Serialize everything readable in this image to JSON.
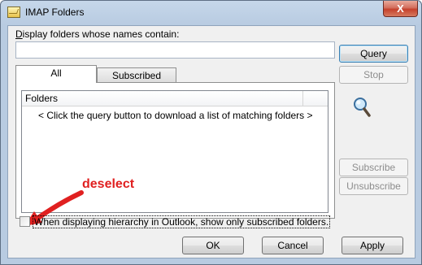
{
  "window": {
    "title": "IMAP Folders",
    "close_glyph": "X"
  },
  "search": {
    "label": "Display folders whose names contain:",
    "value": ""
  },
  "buttons": {
    "query": "Query",
    "stop": "Stop",
    "subscribe": "Subscribe",
    "unsubscribe": "Unsubscribe",
    "ok": "OK",
    "cancel": "Cancel",
    "apply": "Apply"
  },
  "tabs": [
    {
      "label": "All",
      "selected": true
    },
    {
      "label": "Subscribed",
      "selected": false
    }
  ],
  "list": {
    "columns": [
      "Folders"
    ],
    "empty_message": "< Click the query button to download a list of matching folders >"
  },
  "option": {
    "label": "When displaying hierarchy in Outlook, show only subscribed folders.",
    "checked": false
  },
  "annotation": {
    "text": "deselect",
    "color": "#e02020"
  },
  "icons": {
    "app": "folder-icon",
    "search": "magnifier-icon"
  }
}
